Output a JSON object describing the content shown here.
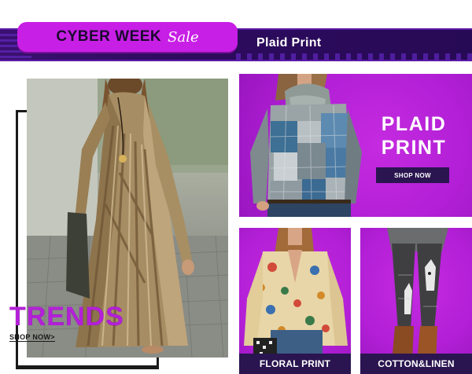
{
  "banner": {
    "cyber_week": "CYBER WEEK",
    "sale": "Sale",
    "category": "Plaid Print"
  },
  "left_panel": {
    "headline": "TRENDS",
    "cta": "SHOP NOW>"
  },
  "plaid_panel": {
    "title": "PLAID\nPRINT",
    "cta": "SHOP NOW"
  },
  "cards": [
    {
      "label": "FLORAL PRINT"
    },
    {
      "label": "COTTON&LINEN"
    }
  ],
  "colors": {
    "accent": "#b420d8",
    "panel": "#b21fd6",
    "dark": "#2a1550",
    "header": "#2d0b5e"
  }
}
